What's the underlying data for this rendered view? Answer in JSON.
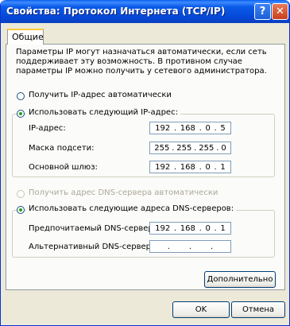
{
  "window": {
    "title": "Свойства: Протокол Интернета (TCP/IP)",
    "help_glyph": "?",
    "close_glyph": "✕"
  },
  "tab": {
    "label": "Общие"
  },
  "description": "Параметры IP могут назначаться автоматически, если сеть поддерживает эту возможность. В противном случае параметры IP можно получить у сетевого администратора.",
  "ip_mode": {
    "auto_label": "Получить IP-адрес автоматически",
    "manual_label": "Использовать следующий IP-адрес:",
    "selected": "manual"
  },
  "ip_fields": {
    "address": {
      "label": "IP-адрес:",
      "octets": [
        "192",
        "168",
        "0",
        "5"
      ]
    },
    "mask": {
      "label": "Маска подсети:",
      "octets": [
        "255",
        "255",
        "255",
        "0"
      ]
    },
    "gateway": {
      "label": "Основной шлюз:",
      "octets": [
        "192",
        "168",
        "0",
        "1"
      ]
    }
  },
  "dns_mode": {
    "auto_label": "Получить адрес DNS-сервера автоматически",
    "manual_label": "Использовать следующие адреса DNS-серверов:",
    "selected": "manual"
  },
  "dns_fields": {
    "preferred": {
      "label": "Предпочитаемый DNS-сервер:",
      "octets": [
        "192",
        "168",
        "0",
        "1"
      ]
    },
    "alternate": {
      "label": "Альтернативный DNS-сервер:",
      "octets": [
        "",
        "",
        "",
        ""
      ]
    }
  },
  "buttons": {
    "advanced": "Дополнительно",
    "ok": "OK",
    "cancel": "Отмена"
  }
}
